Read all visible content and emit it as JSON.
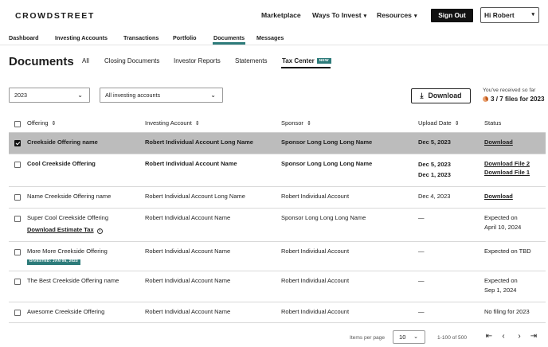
{
  "header": {
    "logo": "CROWDSTREET",
    "nav": [
      {
        "label": "Marketplace",
        "caret": ""
      },
      {
        "label": "Ways To Invest",
        "caret": "▾"
      },
      {
        "label": "Resources",
        "caret": "▾"
      }
    ],
    "sign_out": "Sign Out",
    "user_greeting": "Hi Robert",
    "user_caret": "▾"
  },
  "subnav": {
    "items": [
      "Dashboard",
      "Investing Accounts",
      "Transactions",
      "Portfolio",
      "Documents",
      "Messages"
    ],
    "active": "Documents"
  },
  "page": {
    "title": "Documents",
    "tabs": [
      "All",
      "Closing Documents",
      "Investor Reports",
      "Statements",
      "Tax Center"
    ],
    "active_tab": "Tax Center",
    "new_badge": "NEW"
  },
  "filters": {
    "year": "2023",
    "accounts": "All investing accounts",
    "download_label": "Download",
    "received_label": "You've received so far",
    "received_value": "3 / 7 files for 2023",
    "received_fraction": 0.43
  },
  "table": {
    "columns": [
      "Offering",
      "Investing Account",
      "Sponsor",
      "Upload Date",
      "Status"
    ],
    "rows": [
      {
        "offering": "Creekside Offering name",
        "account": "Robert Individual Account Long Name",
        "sponsor": "Sponsor Long Long Long Name",
        "dates": [
          "Dec 5, 2023"
        ],
        "status_links": [
          "Download"
        ],
        "status_text": ""
      },
      {
        "offering": "Cool Creekside Offering",
        "account": "Robert Individual Account Name",
        "sponsor": "Sponsor Long Long Long Name",
        "dates": [
          "Dec 5, 2023",
          "Dec 1, 2023"
        ],
        "status_links": [
          "Download File 2",
          "Download File 1"
        ],
        "status_text": ""
      },
      {
        "offering": "Name Creekside Offering name",
        "account": "Robert Individual Account Long Name",
        "sponsor": "Robert Individual Account",
        "dates": [
          "Dec 4, 2023"
        ],
        "status_links": [
          "Download"
        ],
        "status_text": ""
      },
      {
        "offering": "Super Cool Creekside Offering",
        "offering_link": "Download Estimate Tax",
        "account": "Robert Individual Account Name",
        "sponsor": "Sponsor Long Long Long Name",
        "dates": [
          "—"
        ],
        "status_links": [],
        "status_text": "Expected on\nApril 10, 2024"
      },
      {
        "offering": "More More Creekside Offering",
        "badge": "DIVESTED: JAN 05, 2023",
        "account": "Robert Individual Account Name",
        "sponsor": "Robert Individual Account",
        "dates": [
          "—"
        ],
        "status_links": [],
        "status_text": "Expected on TBD"
      },
      {
        "offering": "The Best Creekside Offering name",
        "account": "Robert Individual Account Name",
        "sponsor": "Robert Individual Account",
        "dates": [
          "—"
        ],
        "status_links": [],
        "status_text": "Expected on\nSep 1, 2024"
      },
      {
        "offering": "Awesome Creekside Offering",
        "account": "Robert Individual Account Name",
        "sponsor": "Robert Individual Account",
        "dates": [
          "—"
        ],
        "status_links": [],
        "status_text": "No filing for 2023"
      }
    ]
  },
  "pagination": {
    "items_per_page_label": "Items per page",
    "items_per_page": "10",
    "range": "1-100 of 500"
  },
  "colors": {
    "accent": "#2d7b7a",
    "selected_row": "#bcbcbc",
    "primary_button": "#111111"
  }
}
